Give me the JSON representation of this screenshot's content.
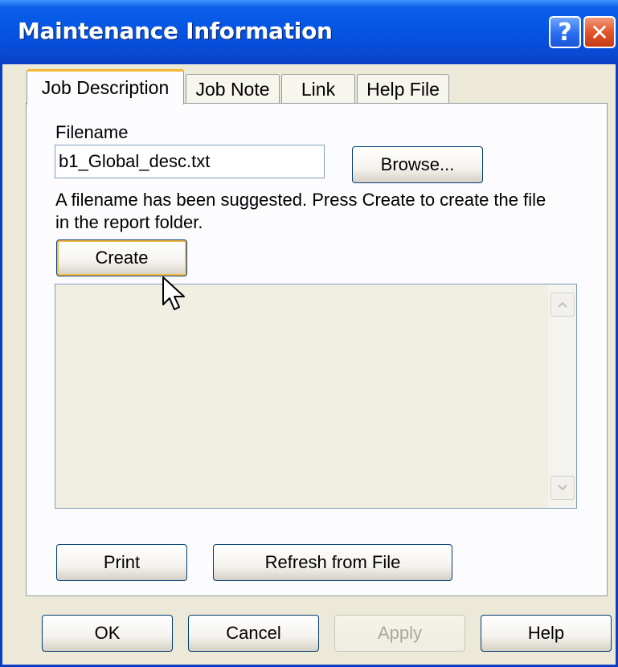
{
  "window": {
    "title": "Maintenance Information",
    "help_glyph": "?",
    "close_glyph": "✕"
  },
  "tabs": [
    {
      "label": "Job Description",
      "active": true
    },
    {
      "label": "Job Note",
      "active": false
    },
    {
      "label": "Link",
      "active": false
    },
    {
      "label": "Help File",
      "active": false
    }
  ],
  "panel": {
    "filename_label": "Filename",
    "filename_value": "b1_Global_desc.txt",
    "browse_label": "Browse...",
    "hint_line1": "A filename has been suggested. Press Create to create the file",
    "hint_line2": "in the report folder.",
    "create_label": "Create",
    "memo_text": "",
    "print_label": "Print",
    "refresh_label": "Refresh from File"
  },
  "footer": {
    "ok_label": "OK",
    "cancel_label": "Cancel",
    "apply_label": "Apply",
    "help_label": "Help"
  },
  "icons": {
    "scroll_up": "chevron-up-icon",
    "scroll_down": "chevron-down-icon",
    "cursor": "mouse-pointer-icon"
  },
  "colors": {
    "titlebar": "#0553e3",
    "focus_ring": "#f8b942",
    "close_button": "#e2552b"
  }
}
